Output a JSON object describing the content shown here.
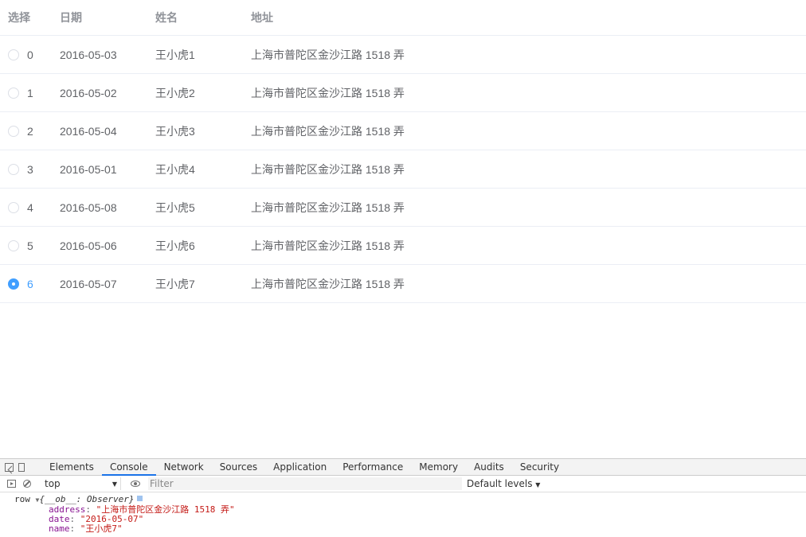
{
  "table": {
    "headers": {
      "select": "选择",
      "date": "日期",
      "name": "姓名",
      "address": "地址"
    },
    "rows": [
      {
        "index": "0",
        "date": "2016-05-03",
        "name": "王小虎1",
        "address": "上海市普陀区金沙江路 1518 弄",
        "selected": false
      },
      {
        "index": "1",
        "date": "2016-05-02",
        "name": "王小虎2",
        "address": "上海市普陀区金沙江路 1518 弄",
        "selected": false
      },
      {
        "index": "2",
        "date": "2016-05-04",
        "name": "王小虎3",
        "address": "上海市普陀区金沙江路 1518 弄",
        "selected": false
      },
      {
        "index": "3",
        "date": "2016-05-01",
        "name": "王小虎4",
        "address": "上海市普陀区金沙江路 1518 弄",
        "selected": false
      },
      {
        "index": "4",
        "date": "2016-05-08",
        "name": "王小虎5",
        "address": "上海市普陀区金沙江路 1518 弄",
        "selected": false
      },
      {
        "index": "5",
        "date": "2016-05-06",
        "name": "王小虎6",
        "address": "上海市普陀区金沙江路 1518 弄",
        "selected": false
      },
      {
        "index": "6",
        "date": "2016-05-07",
        "name": "王小虎7",
        "address": "上海市普陀区金沙江路 1518 弄",
        "selected": true
      }
    ],
    "accent_color": "#409eff"
  },
  "devtools": {
    "tabs": [
      "Elements",
      "Console",
      "Network",
      "Sources",
      "Application",
      "Performance",
      "Memory",
      "Audits",
      "Security"
    ],
    "active_tab": "Console",
    "toolbar": {
      "context": "top",
      "filter_placeholder": "Filter",
      "levels": "Default levels"
    },
    "console": {
      "label": "row",
      "object_summary": "{__ob__: Observer}",
      "fields": [
        {
          "key": "address",
          "value": "\"上海市普陀区金沙江路 1518 弄\""
        },
        {
          "key": "date",
          "value": "\"2016-05-07\""
        },
        {
          "key": "name",
          "value": "\"王小虎7\""
        }
      ]
    }
  }
}
